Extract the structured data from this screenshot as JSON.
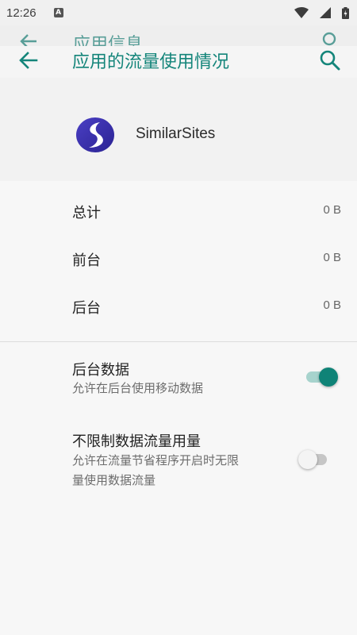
{
  "status_bar": {
    "time": "12:26",
    "notification_letter": "A"
  },
  "ghost_bar": {
    "title": "应用信息"
  },
  "app_bar": {
    "title": "应用的流量使用情况"
  },
  "app": {
    "name": "SimilarSites"
  },
  "usage": [
    {
      "label": "总计",
      "value": "0 B"
    },
    {
      "label": "前台",
      "value": "0 B"
    },
    {
      "label": "后台",
      "value": "0 B"
    }
  ],
  "settings": {
    "background_data": {
      "title": "后台数据",
      "summary": "允许在后台使用移动数据",
      "enabled": true
    },
    "unrestricted_data": {
      "title": "不限制数据流量用量",
      "summary_line1": "允许在流量节省程序开启时无限",
      "summary_line2": "量使用数据流量",
      "enabled": false
    }
  },
  "colors": {
    "accent": "#14857a",
    "switch_on_thumb": "#0f8377",
    "switch_on_track": "#a7d3cd"
  }
}
